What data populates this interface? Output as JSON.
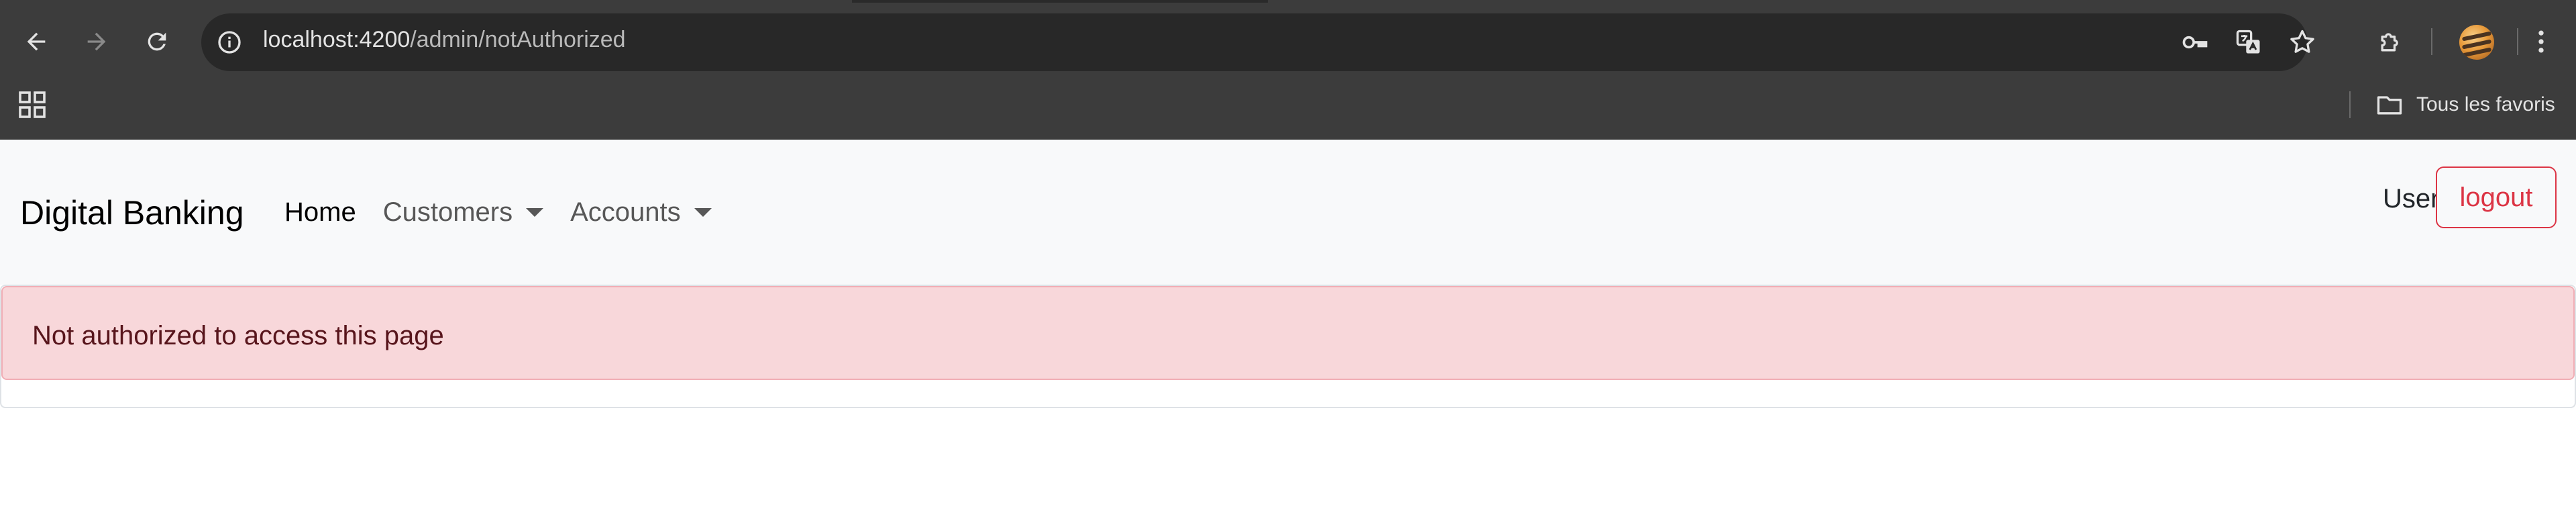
{
  "browser": {
    "url_host": "localhost:4200",
    "url_path": "/admin/notAuthorized",
    "icons": {
      "back": "arrow-left-icon",
      "forward": "arrow-right-icon",
      "reload": "reload-icon",
      "site_info": "info-icon",
      "passwords": "key-icon",
      "translate": "translate-icon",
      "bookmark": "star-icon",
      "extensions": "puzzle-icon",
      "menu": "kebab-menu-icon",
      "apps": "apps-grid-icon",
      "folder": "folder-icon"
    },
    "bookmarks_folder": "Tous les favoris"
  },
  "navbar": {
    "brand": "Digital Banking",
    "links": [
      {
        "label": "Home",
        "active": true,
        "dropdown": false
      },
      {
        "label": "Customers",
        "active": false,
        "dropdown": true
      },
      {
        "label": "Accounts",
        "active": false,
        "dropdown": true
      }
    ],
    "user_label": "User",
    "logout_label": "logout"
  },
  "alert": {
    "message": "Not authorized to access this page",
    "variant": "danger"
  },
  "colors": {
    "chrome_bg": "#3c3c3c",
    "omnibox_bg": "#282828",
    "navbar_bg": "#f8f9fa",
    "alert_bg": "#f8d7da",
    "alert_border": "#f1aeb5",
    "alert_text": "#58151c",
    "danger": "#dc3545"
  }
}
